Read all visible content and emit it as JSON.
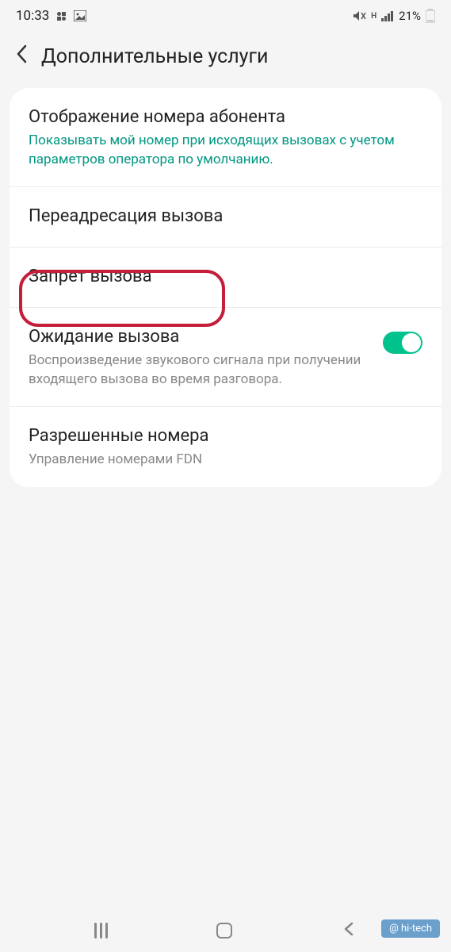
{
  "statusBar": {
    "time": "10:33",
    "battery": "21%"
  },
  "header": {
    "title": "Дополнительные услуги"
  },
  "settings": {
    "callerId": {
      "title": "Отображение номера абонента",
      "subtitle": "Показывать мой номер при исходящих вызовах с учетом параметров оператора по умолчанию."
    },
    "callForwarding": {
      "title": "Переадресация вызова"
    },
    "callBarring": {
      "title": "Запрет вызова"
    },
    "callWaiting": {
      "title": "Ожидание вызова",
      "subtitle": "Воспроизведение звукового сигнала при получении входящего вызова во время разговора.",
      "enabled": true
    },
    "allowedNumbers": {
      "title": "Разрешенные номера",
      "subtitle": "Управление номерами FDN"
    }
  },
  "watermark": "@ hi-tech",
  "accentColor": "#009783",
  "highlightColor": "#c41e3a"
}
